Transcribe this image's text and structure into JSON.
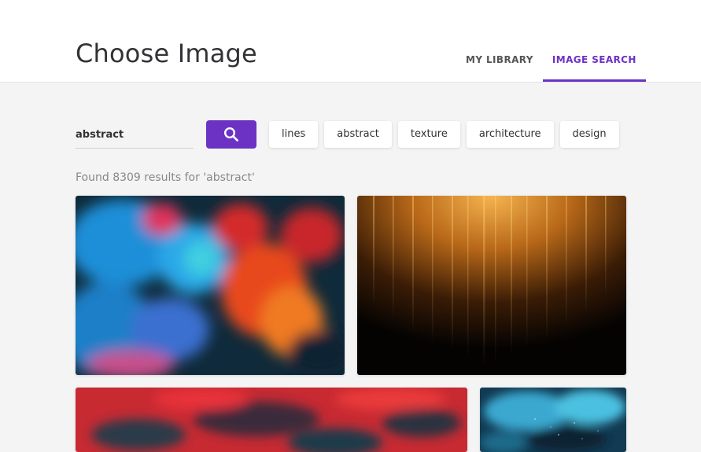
{
  "header": {
    "title": "Choose Image",
    "tabs": [
      {
        "label": "MY LIBRARY",
        "active": false
      },
      {
        "label": "IMAGE SEARCH",
        "active": true
      }
    ]
  },
  "search": {
    "value": "abstract",
    "button_icon": "search-icon"
  },
  "suggestions": [
    "lines",
    "abstract",
    "texture",
    "architecture",
    "design"
  ],
  "results": {
    "summary": "Found 8309 results for 'abstract'"
  },
  "colors": {
    "accent": "#6b32c4",
    "background": "#f4f4f5"
  }
}
